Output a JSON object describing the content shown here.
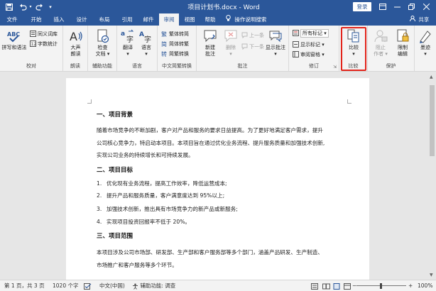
{
  "titlebar": {
    "title": "项目计划书.docx - Word",
    "login": "登录",
    "save_icon": "save-icon",
    "undo_icon": "undo-icon",
    "redo_icon": "redo-icon",
    "ribbon_display_icon": "ribbon-display-icon"
  },
  "menu": {
    "tabs": [
      "文件",
      "开始",
      "插入",
      "设计",
      "布局",
      "引用",
      "邮件",
      "审阅",
      "视图",
      "帮助"
    ],
    "active": "审阅",
    "tell_me": "操作说明搜索",
    "share": "共享"
  },
  "ribbon": {
    "proofing": {
      "spelling": "拼写和语法",
      "thesaurus": "同义词库",
      "word_count": "字数统计",
      "label": "校对"
    },
    "speech": {
      "read_aloud_1": "大声",
      "read_aloud_2": "朗读",
      "label": "朗读"
    },
    "accessibility": {
      "check_1": "检查",
      "check_2": "文档",
      "label": "辅助功能"
    },
    "language": {
      "translate": "翻译",
      "language": "语言",
      "label": "语言"
    },
    "chinese_conversion": {
      "to_trad": "繁体转简",
      "to_simp": "简体转繁",
      "convert": "简繁转换",
      "label": "中文简繁转换"
    },
    "comments": {
      "new_1": "新建",
      "new_2": "批注",
      "delete": "删除",
      "previous": "上一条",
      "next": "下一条",
      "show_1": "显示批注",
      "label": "批注"
    },
    "tracking": {
      "markup": "所有标记",
      "show_markup": "显示标记",
      "reviewing_pane": "审阅窗格",
      "label": "修订"
    },
    "compare": {
      "compare": "比较",
      "label": "比较"
    },
    "protect": {
      "block_1": "阻止",
      "block_2": "作者",
      "restrict_1": "限制",
      "restrict_2": "编辑",
      "label": "保护"
    },
    "ink": {
      "hide": "墨迹"
    }
  },
  "document": {
    "h1": "一、项目背景",
    "p1_line1": "随着市场竞争的不断加剧，客户对产品和服务的要求日益提高。为了更好地满足客户需求，提升",
    "p1_line2": "公司核心竞争力，特启动本项目。本项目旨在通过优化业务流程、提升服务质量和加强技术创新,",
    "p1_line3": "实现公司业务的持续增长和可持续发展。",
    "h2": "二、项目目标",
    "goals": [
      {
        "num": "1.",
        "text": "优化现有业务流程，提高工作效率，降低运营成本;"
      },
      {
        "num": "2.",
        "text": "提升产品和服务质量，客户满意度达到 95%以上;"
      },
      {
        "num": "3.",
        "text": "加强技术创新，推出具有市场竞争力的新产品或新服务;"
      },
      {
        "num": "4.",
        "text": "实现项目投资回报率不低于 20%。"
      }
    ],
    "h3": "三、项目范围",
    "p3_line1": "本项目涉及公司市场部、研发部、生产部和客户服务部等多个部门，涵盖产品研发、生产制造、",
    "p3_line2": "市场推广和客户服务等多个环节。"
  },
  "status": {
    "page": "第 1 页，共 3 页",
    "words": "1020 个字",
    "lang": "中文(中国)",
    "accessibility": "辅助功能: 调查",
    "zoom": "100%"
  },
  "colors": {
    "brand": "#2b579a",
    "highlight": "#e2231a"
  }
}
